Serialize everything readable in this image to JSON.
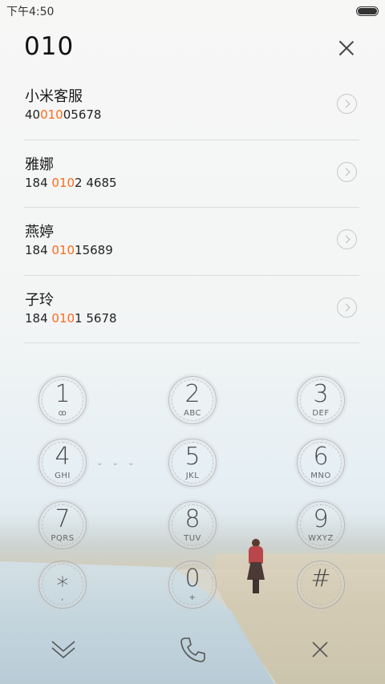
{
  "status_bar": {
    "time": "下午4:50",
    "battery_level": 1.0
  },
  "dialer": {
    "input": "010",
    "results": [
      {
        "name": "小米客服",
        "number_parts": [
          "40",
          "010",
          "05678"
        ]
      },
      {
        "name": "雅娜",
        "number_parts": [
          "184 ",
          "010",
          "2 4685"
        ]
      },
      {
        "name": "燕婷",
        "number_parts": [
          "184 ",
          "010",
          "15689"
        ]
      },
      {
        "name": "子玲",
        "number_parts": [
          "184 ",
          "010",
          "1 5678"
        ]
      }
    ],
    "keys": [
      {
        "digit": "1",
        "letters": "ꝏ",
        "icon": "voicemail-icon"
      },
      {
        "digit": "2",
        "letters": "ABC"
      },
      {
        "digit": "3",
        "letters": "DEF"
      },
      {
        "digit": "4",
        "letters": "GHI"
      },
      {
        "digit": "5",
        "letters": "JKL"
      },
      {
        "digit": "6",
        "letters": "MNO"
      },
      {
        "digit": "7",
        "letters": "PQRS"
      },
      {
        "digit": "8",
        "letters": "TUV"
      },
      {
        "digit": "9",
        "letters": "WXYZ"
      },
      {
        "digit": "⁎",
        "letters": ",",
        "icon": "star-key"
      },
      {
        "digit": "0",
        "letters": "+"
      },
      {
        "digit": "#",
        "letters": ""
      }
    ],
    "actions": [
      {
        "name": "collapse-keypad",
        "icon": "double-chevron-down-icon"
      },
      {
        "name": "call",
        "icon": "phone-icon"
      },
      {
        "name": "delete-digit",
        "icon": "close-icon"
      }
    ]
  },
  "colors": {
    "highlight": "#ff6a1a",
    "text": "#222222",
    "divider": "#dcdcdc"
  }
}
